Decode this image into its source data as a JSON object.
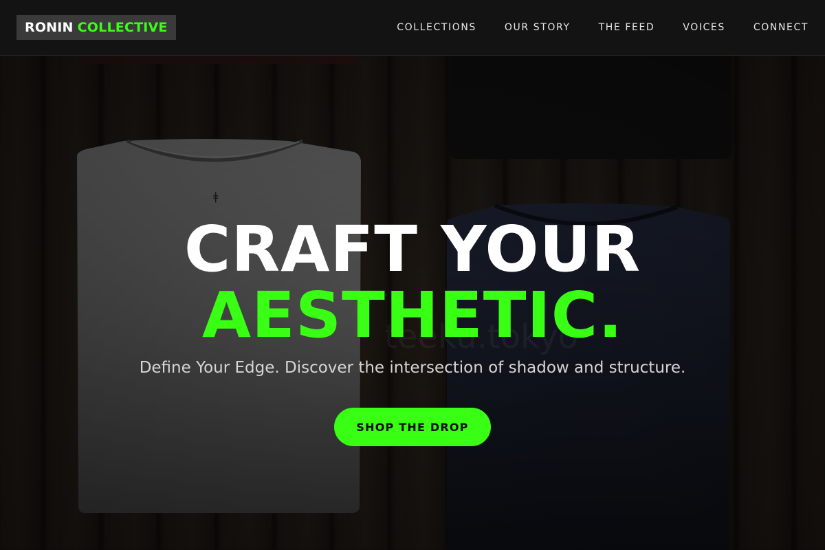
{
  "brand": {
    "name_part1": "RONIN",
    "name_part2": "COLLECTIVE"
  },
  "nav": {
    "items": [
      {
        "label": "COLLECTIONS"
      },
      {
        "label": "OUR STORY"
      },
      {
        "label": "THE FEED"
      },
      {
        "label": "VOICES"
      },
      {
        "label": "CONNECT"
      }
    ]
  },
  "hero": {
    "headline_line1": "CRAFT YOUR",
    "headline_line2": "AESTHETIC.",
    "subhead": "Define Your Edge. Discover the intersection of shadow and structure.",
    "cta_label": "SHOP THE DROP"
  },
  "colors": {
    "accent": "#39ff14",
    "header_bg": "#131313",
    "logo_bg": "#3a3a3a",
    "text_primary": "#ffffff"
  }
}
